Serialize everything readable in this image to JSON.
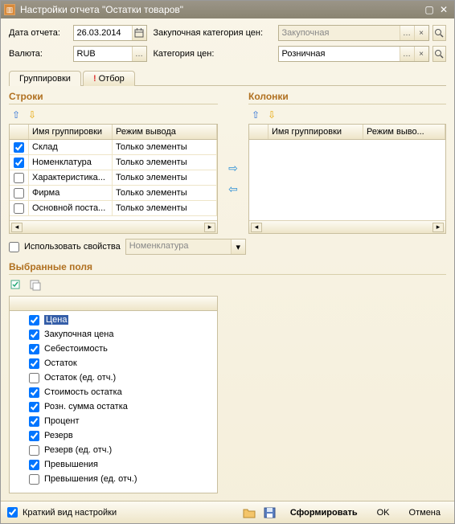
{
  "window": {
    "title": "Настройки отчета  \"Остатки товаров\""
  },
  "form": {
    "date_label": "Дата отчета:",
    "date_value": "26.03.2014",
    "purchase_cat_label": "Закупочная категория цен:",
    "purchase_cat_value": "Закупочная",
    "currency_label": "Валюта:",
    "currency_value": "RUB",
    "price_cat_label": "Категория цен:",
    "price_cat_value": "Розничная"
  },
  "tabs": {
    "groupings": "Группировки",
    "filter": "Отбор"
  },
  "groupings": {
    "rows_title": "Строки",
    "cols_title": "Колонки",
    "header_name": "Имя группировки",
    "header_mode": "Режим вывода",
    "header_mode_short": "Режим выво...",
    "rows": [
      {
        "checked": true,
        "name": "Склад",
        "mode": "Только элементы"
      },
      {
        "checked": true,
        "name": "Номенклатура",
        "mode": "Только элементы"
      },
      {
        "checked": false,
        "name": "Характеристика...",
        "mode": "Только элементы"
      },
      {
        "checked": false,
        "name": "Фирма",
        "mode": "Только элементы"
      },
      {
        "checked": false,
        "name": "Основной поста...",
        "mode": "Только элементы"
      }
    ]
  },
  "use_props": {
    "label": "Использовать свойства",
    "checked": false,
    "dropdown": "Номенклатура"
  },
  "selected_fields": {
    "title": "Выбранные поля",
    "items": [
      {
        "checked": true,
        "label": "Цена",
        "selected": true
      },
      {
        "checked": true,
        "label": "Закупочная цена"
      },
      {
        "checked": true,
        "label": "Себестоимость"
      },
      {
        "checked": true,
        "label": "Остаток"
      },
      {
        "checked": false,
        "label": "Остаток (ед. отч.)"
      },
      {
        "checked": true,
        "label": "Стоимость остатка"
      },
      {
        "checked": true,
        "label": "Розн. сумма остатка"
      },
      {
        "checked": true,
        "label": "Процент"
      },
      {
        "checked": true,
        "label": "Резерв"
      },
      {
        "checked": false,
        "label": "Резерв (ед. отч.)"
      },
      {
        "checked": true,
        "label": "Превышения"
      },
      {
        "checked": false,
        "label": "Превышения (ед. отч.)"
      }
    ]
  },
  "footer": {
    "short_view_label": "Краткий вид настройки",
    "short_view_checked": true,
    "generate": "Сформировать",
    "ok": "OK",
    "cancel": "Отмена"
  }
}
